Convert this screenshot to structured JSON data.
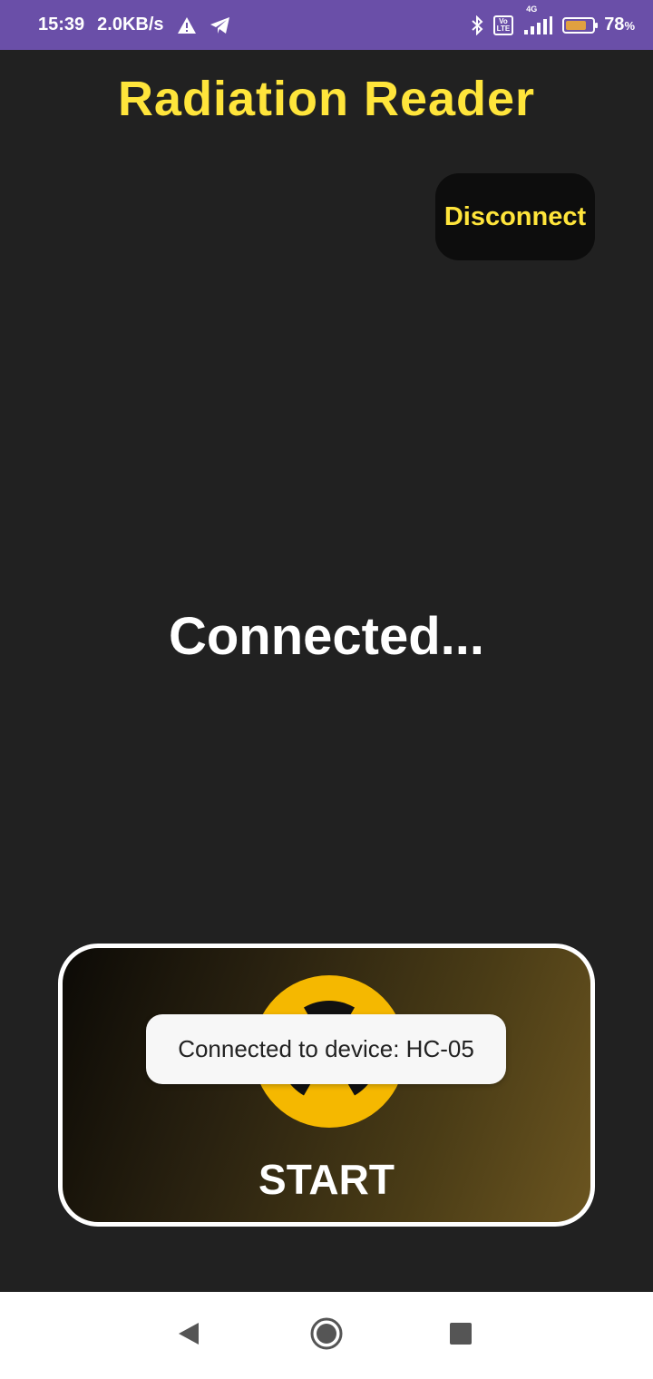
{
  "status_bar": {
    "time": "15:39",
    "net_speed": "2.0KB/s",
    "icons": [
      "warning-icon",
      "telegram-icon",
      "bluetooth-icon",
      "volte-icon",
      "signal-4g-icon",
      "battery-icon"
    ],
    "volte_top": "Vo",
    "volte_bottom": "LTE",
    "network_type": "4G",
    "battery_percent": "78",
    "battery_unit": "%",
    "battery_level": 0.78
  },
  "app": {
    "title": "Radiation Reader",
    "disconnect_label": "Disconnect",
    "connection_status": "Connected...",
    "start_label": "START",
    "start_icon": "radiation-icon"
  },
  "toast": {
    "message": "Connected to device: HC-05"
  },
  "nav_bar": {
    "icons": [
      "back-icon",
      "home-icon",
      "recents-icon"
    ]
  },
  "colors": {
    "status_bar_bg": "#6a4fa8",
    "background": "#212121",
    "accent_yellow": "#ffe53b",
    "radiation_yellow": "#f5b800"
  }
}
